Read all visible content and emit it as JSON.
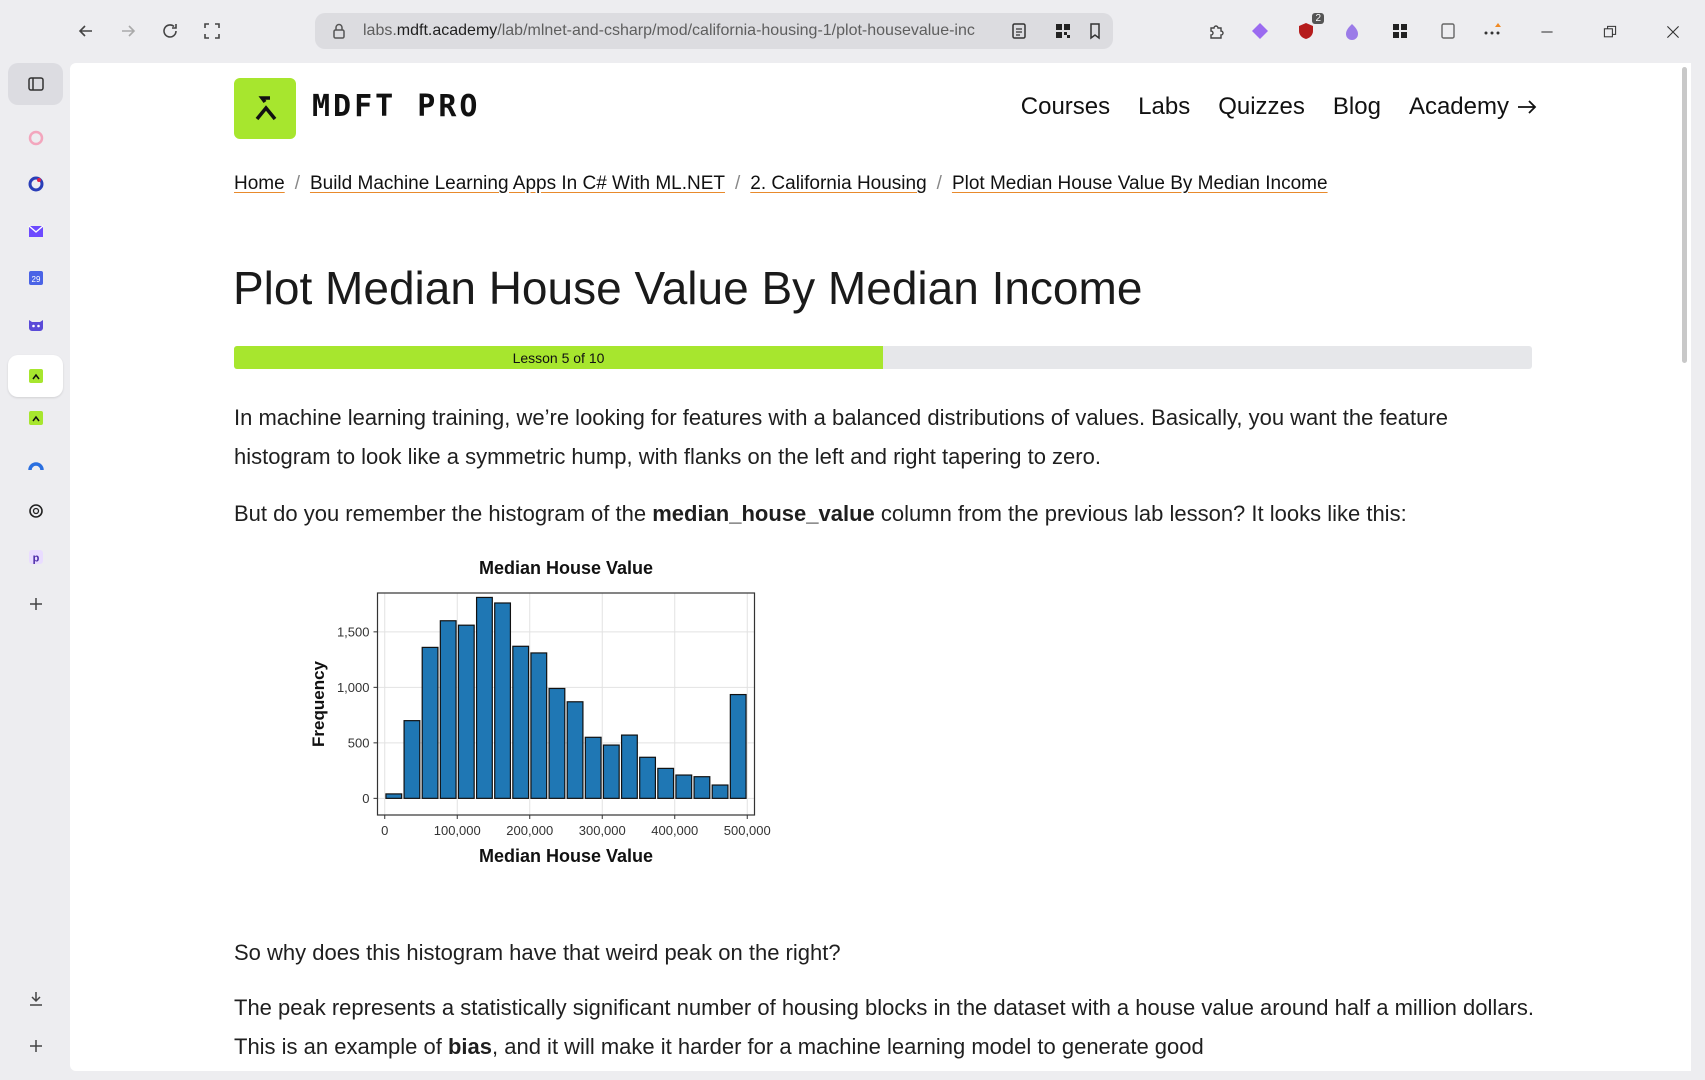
{
  "browser": {
    "url_prefix": "labs.",
    "url_domain": "mdft.academy",
    "url_path": "/lab/mlnet-and-csharp/mod/california-housing-1/plot-housevalue-inc",
    "badge_count": "2"
  },
  "site": {
    "brand": "MDFT PRO",
    "nav": [
      {
        "label": "Courses"
      },
      {
        "label": "Labs"
      },
      {
        "label": "Quizzes"
      },
      {
        "label": "Blog"
      },
      {
        "label": "Academy"
      }
    ]
  },
  "breadcrumb": [
    {
      "label": "Home"
    },
    {
      "label": "Build Machine Learning Apps In C# With ML.NET"
    },
    {
      "label": "2. California Housing"
    },
    {
      "label": "Plot Median House Value By Median Income"
    }
  ],
  "page": {
    "title": "Plot Median House Value By Median Income",
    "progress_label": "Lesson 5 of 10",
    "progress_fraction": 0.5,
    "paragraph1": "In machine learning training, we’re looking for features with a balanced distributions of values. Basically, you want the feature histogram to look like a symmetric hump, with flanks on the left and right tapering to zero.",
    "paragraph2_before": "But do you remember the histogram of the ",
    "paragraph2_bold": "median_house_value",
    "paragraph2_after": " column from the previous lab lesson? It looks like this:",
    "paragraph3": "So why does this histogram have that weird peak on the right?",
    "paragraph4_before": "The peak represents a statistically significant number of housing blocks in the dataset with a house value around half a million dollars. This is an example of ",
    "paragraph4_bold": "bias",
    "paragraph4_after": ", and it will make it harder for a machine learning model to generate good"
  },
  "chart_data": {
    "type": "bar",
    "title": "Median House Value",
    "xlabel": "Median House Value",
    "ylabel": "Frequency",
    "bin_width": 25000,
    "bin_starts": [
      0,
      25000,
      50000,
      75000,
      100000,
      125000,
      150000,
      175000,
      200000,
      225000,
      250000,
      275000,
      300000,
      325000,
      350000,
      375000,
      400000,
      425000,
      450000,
      475000
    ],
    "values": [
      40,
      700,
      1360,
      1600,
      1560,
      1810,
      1760,
      1370,
      1310,
      990,
      870,
      550,
      480,
      570,
      370,
      270,
      210,
      195,
      120,
      935
    ],
    "xlim": [
      -10000,
      510000
    ],
    "ylim": [
      -150,
      1850
    ],
    "x_ticks": [
      0,
      100000,
      200000,
      300000,
      400000,
      500000
    ],
    "x_tick_labels": [
      "0",
      "100,000",
      "200,000",
      "300,000",
      "400,000",
      "500,000"
    ],
    "y_ticks": [
      0,
      500,
      1000,
      1500
    ],
    "y_tick_labels": [
      "0",
      "500",
      "1,000",
      "1,500"
    ],
    "bar_color": "#1f77b4",
    "grid": true
  },
  "colors": {
    "accent": "#a7e62e",
    "link_underline": "#e88a2c"
  }
}
